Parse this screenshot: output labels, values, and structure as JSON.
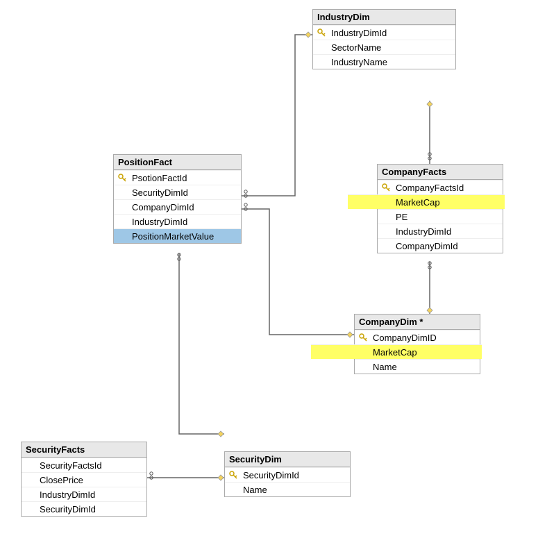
{
  "tables": {
    "industryDim": {
      "title": "IndustryDim",
      "cols": [
        "IndustryDimId",
        "SectorName",
        "IndustryName"
      ]
    },
    "positionFact": {
      "title": "PositionFact",
      "cols": [
        "PsotionFactId",
        "SecurityDimId",
        "CompanyDimId",
        "IndustryDimId",
        "PositionMarketValue"
      ]
    },
    "companyFacts": {
      "title": "CompanyFacts",
      "cols": [
        "CompanyFactsId",
        "MarketCap",
        "PE",
        "IndustryDimId",
        "CompanyDimId"
      ]
    },
    "companyDim": {
      "title": "CompanyDim *",
      "cols": [
        "CompanyDimID",
        "MarketCap",
        "Name"
      ]
    },
    "securityFacts": {
      "title": "SecurityFacts",
      "cols": [
        "SecurityFactsId",
        "ClosePrice",
        "IndustryDimId",
        "SecurityDimId"
      ]
    },
    "securityDim": {
      "title": "SecurityDim",
      "cols": [
        "SecurityDimId",
        "Name"
      ]
    }
  },
  "highlights": {
    "yellow_rows": [
      "companyFacts.MarketCap",
      "companyDim.MarketCap"
    ],
    "blue_rows": [
      "positionFact.PositionMarketValue"
    ]
  },
  "relationships": [
    {
      "from": "PositionFact.IndustryDimId",
      "to": "IndustryDim.IndustryDimId",
      "type": "many-to-one"
    },
    {
      "from": "PositionFact.CompanyDimId",
      "to": "CompanyDim.CompanyDimID",
      "type": "many-to-one"
    },
    {
      "from": "PositionFact.SecurityDimId",
      "to": "SecurityDim.SecurityDimId",
      "type": "many-to-one"
    },
    {
      "from": "CompanyFacts.IndustryDimId",
      "to": "IndustryDim.IndustryDimId",
      "type": "many-to-one"
    },
    {
      "from": "CompanyFacts.CompanyDimId",
      "to": "CompanyDim.CompanyDimID",
      "type": "many-to-one"
    },
    {
      "from": "SecurityFacts.SecurityDimId",
      "to": "SecurityDim.SecurityDimId",
      "type": "many-to-one"
    }
  ]
}
